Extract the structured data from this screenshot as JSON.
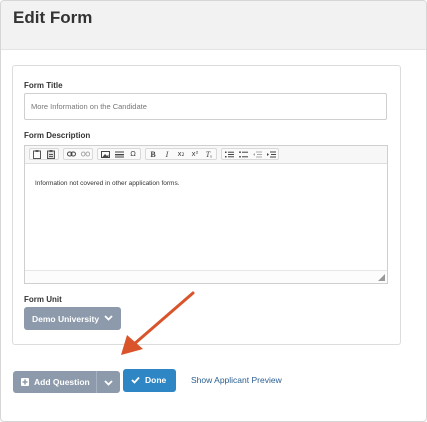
{
  "header": {
    "title": "Edit Form"
  },
  "form": {
    "title_label": "Form Title",
    "title_value": "More Information on the Candidate",
    "description_label": "Form Description",
    "description_text": "Information not covered in other application forms.",
    "unit_label": "Form Unit",
    "unit_value": "Demo University"
  },
  "editor_toolbar": {
    "groups": [
      [
        "paste-icon",
        "paste-text-icon"
      ],
      [
        "link-icon",
        "unlink-icon"
      ],
      [
        "image-icon",
        "horizontal-rule-icon",
        "special-char-icon"
      ],
      [
        "bold-icon",
        "italic-icon",
        "subscript-icon",
        "superscript-icon",
        "remove-format-icon"
      ],
      [
        "numbered-list-icon",
        "bullet-list-icon",
        "outdent-icon",
        "indent-icon"
      ]
    ],
    "glyphs": {
      "special_char": "Ω",
      "bold": "B",
      "italic": "I",
      "subscript": "x₂",
      "superscript": "x²",
      "remove_format": "Tₓ"
    }
  },
  "actions": {
    "add_question_label": "Add Question",
    "done_label": "Done",
    "preview_label": "Show Applicant Preview"
  },
  "colors": {
    "header_bg": "#f2f2f2",
    "gray_button": "#8d9aab",
    "primary_button": "#2f86c4",
    "link": "#2a5e8f",
    "annotation_arrow": "#d9542b"
  }
}
